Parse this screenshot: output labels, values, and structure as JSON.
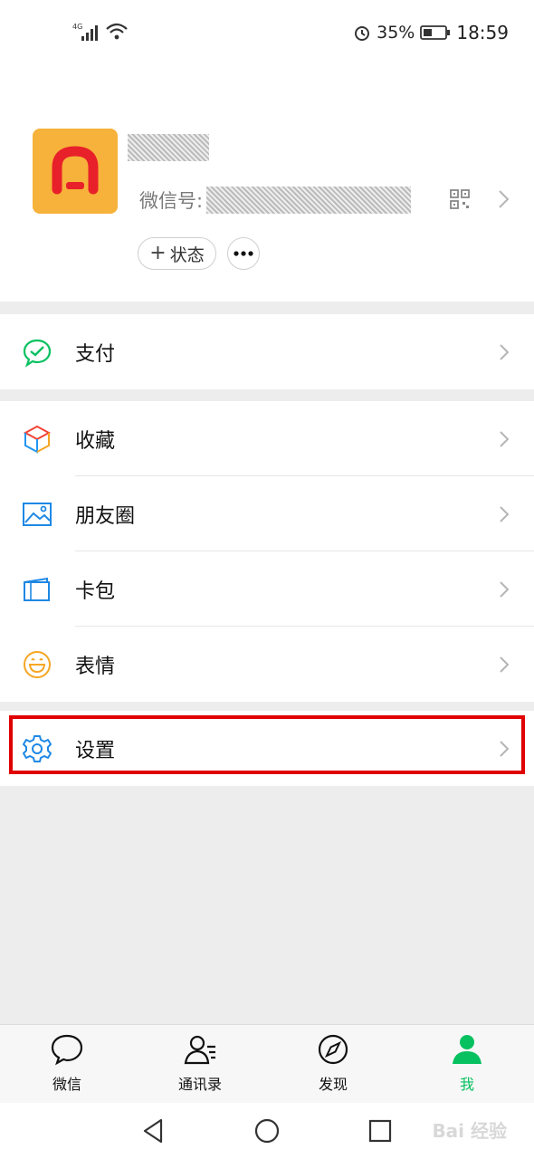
{
  "status_bar": {
    "network": "4G",
    "battery_percent": "35%",
    "time": "18:59"
  },
  "profile": {
    "wechat_id_label": "微信号:",
    "status_label": "状态"
  },
  "menu": {
    "pay": "支付",
    "favorites": "收藏",
    "moments": "朋友圈",
    "cards": "卡包",
    "stickers": "表情",
    "settings": "设置"
  },
  "tabs": [
    {
      "label": "微信",
      "icon": "chat-bubble-icon"
    },
    {
      "label": "通讯录",
      "icon": "contacts-icon"
    },
    {
      "label": "发现",
      "icon": "compass-icon"
    },
    {
      "label": "我",
      "icon": "person-icon"
    }
  ],
  "watermark": "Bai 经验",
  "colors": {
    "accent_green": "#07c160",
    "highlight_red": "#e00000",
    "avatar_bg": "#f6b23a"
  }
}
